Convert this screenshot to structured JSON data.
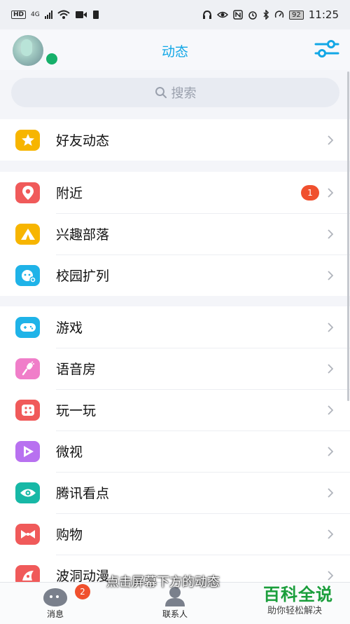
{
  "status_bar": {
    "hd_label": "HD",
    "network": "4G",
    "battery": "92",
    "time": "11:25"
  },
  "header": {
    "title": "动态"
  },
  "search": {
    "placeholder": "搜索"
  },
  "groups": [
    {
      "items": [
        {
          "label": "好友动态",
          "icon": "star-icon",
          "color": "#f7b500"
        }
      ]
    },
    {
      "items": [
        {
          "label": "附近",
          "icon": "location-pin-icon",
          "color": "#f05a5a",
          "badge": "1"
        },
        {
          "label": "兴趣部落",
          "icon": "tent-icon",
          "color": "#f7b500"
        },
        {
          "label": "校园扩列",
          "icon": "campus-face-icon",
          "color": "#1fb3e8"
        }
      ]
    },
    {
      "items": [
        {
          "label": "游戏",
          "icon": "gamepad-icon",
          "color": "#1fb3e8"
        },
        {
          "label": "语音房",
          "icon": "microphone-icon",
          "color": "#f07ec9"
        },
        {
          "label": "玩一玩",
          "icon": "mini-game-icon",
          "color": "#f05a5a"
        },
        {
          "label": "微视",
          "icon": "play-icon",
          "color": "#b871f0"
        },
        {
          "label": "腾讯看点",
          "icon": "eye-icon",
          "color": "#17b8a6"
        },
        {
          "label": "购物",
          "icon": "bow-icon",
          "color": "#f05a5a"
        },
        {
          "label": "波洞动漫",
          "icon": "comic-icon",
          "color": "#f05a5a"
        }
      ]
    }
  ],
  "tabbar": [
    {
      "label": "消息",
      "badge": "2"
    },
    {
      "label": "联系人"
    }
  ],
  "overlay": {
    "subtitle": "点击屏幕下方的动态",
    "watermark_title": "百科全说",
    "watermark_sub": "助你轻松解决"
  }
}
